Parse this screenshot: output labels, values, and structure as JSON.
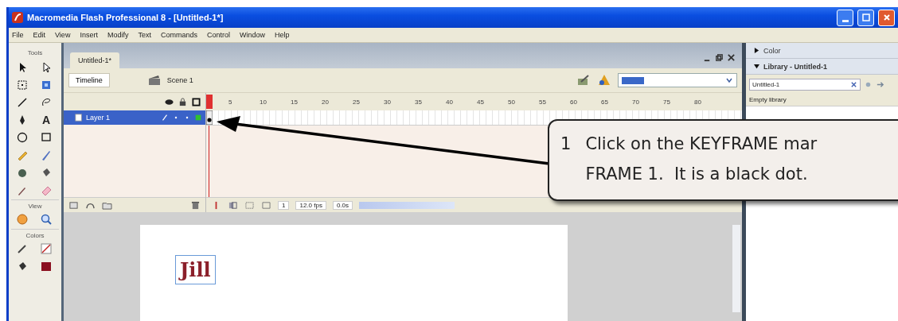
{
  "window": {
    "title": "Macromedia Flash Professional 8 - [Untitled-1*]"
  },
  "menu": [
    "File",
    "Edit",
    "View",
    "Insert",
    "Modify",
    "Text",
    "Commands",
    "Control",
    "Window",
    "Help"
  ],
  "tools": {
    "title": "Tools",
    "text_tool": "A",
    "view_title": "View",
    "colors_title": "Colors"
  },
  "document": {
    "tab": "Untitled-1*",
    "timeline_button": "Timeline",
    "scene": "Scene 1",
    "frame_numbers": [
      "5",
      "10",
      "15",
      "20",
      "25",
      "30",
      "35",
      "40",
      "45",
      "50",
      "55",
      "60",
      "65",
      "70",
      "75",
      "80"
    ],
    "layers": [
      {
        "name": "Layer 1",
        "selected": true
      }
    ],
    "status": {
      "frame": "1",
      "fps": "12.0 fps",
      "time": "0.0s"
    },
    "stage_text": "Jill"
  },
  "panels": [
    {
      "title": "Color",
      "expanded": false
    },
    {
      "title": "Library - Untitled-1",
      "expanded": true,
      "document": "Untitled-1",
      "empty_message": "Empty library"
    }
  ],
  "callout": {
    "number": "1",
    "text": "Click on the KEYFRAME mar\nFRAME 1.  It is a black dot."
  }
}
